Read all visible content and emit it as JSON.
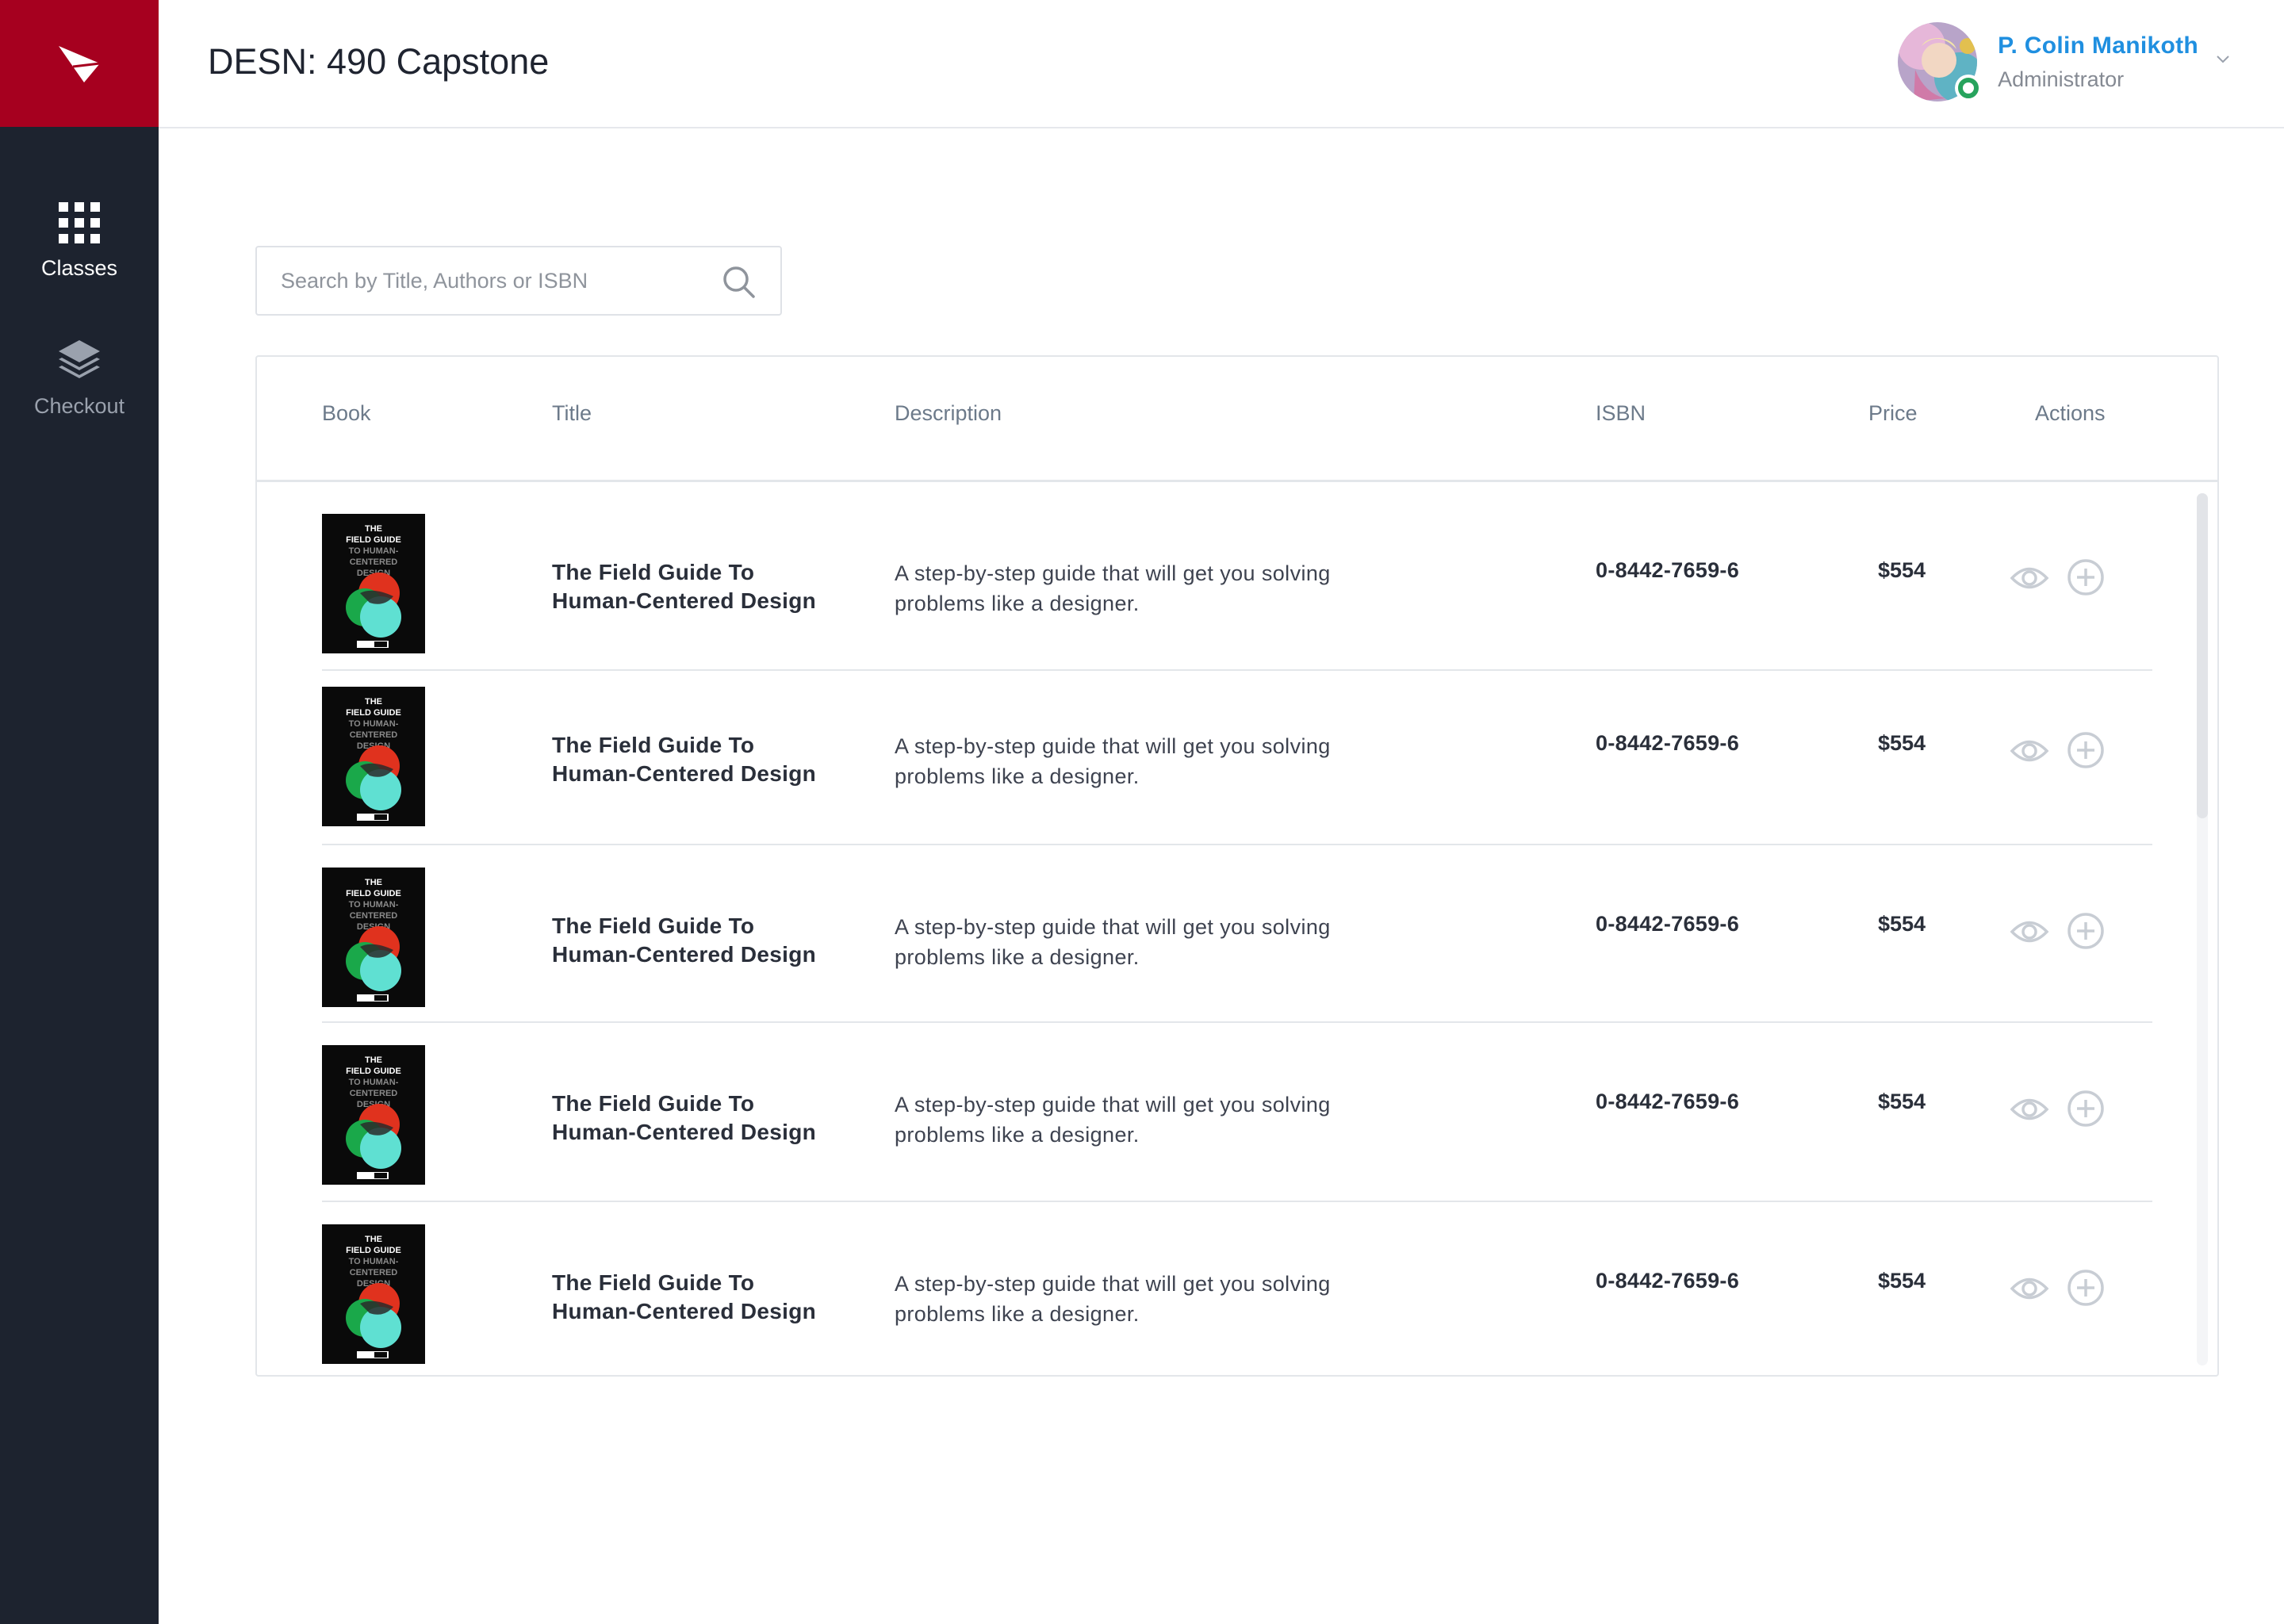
{
  "app": {
    "title": "DESN: 490 Capstone"
  },
  "sidebar": {
    "items": [
      {
        "label": "Classes",
        "icon": "grid-icon",
        "active": true
      },
      {
        "label": "Checkout",
        "icon": "layers-icon",
        "active": false
      }
    ]
  },
  "user": {
    "name": "P. Colin Manikoth",
    "role": "Administrator",
    "status": "online",
    "status_color": "#27a35d"
  },
  "search": {
    "placeholder": "Search by Title, Authors or ISBN",
    "value": ""
  },
  "table": {
    "columns": [
      "Book",
      "Title",
      "Description",
      "ISBN",
      "Price",
      "Actions"
    ],
    "rows": [
      {
        "cover_text": "THE FIELD GUIDE TO HUMAN-CENTERED DESIGN",
        "title_line1": "The Field Guide To",
        "title_line2": "Human-Centered Design",
        "desc_line1": "A step-by-step guide that will get you solving",
        "desc_line2": "problems like a designer.",
        "isbn": "0-8442-7659-6",
        "price": "$554"
      },
      {
        "cover_text": "THE FIELD GUIDE TO HUMAN-CENTERED DESIGN",
        "title_line1": "The Field Guide To",
        "title_line2": "Human-Centered Design",
        "desc_line1": "A step-by-step guide that will get you solving",
        "desc_line2": "problems like a designer.",
        "isbn": "0-8442-7659-6",
        "price": "$554"
      },
      {
        "cover_text": "THE FIELD GUIDE TO HUMAN-CENTERED DESIGN",
        "title_line1": "The Field Guide To",
        "title_line2": "Human-Centered Design",
        "desc_line1": "A step-by-step guide that will get you solving",
        "desc_line2": "problems like a designer.",
        "isbn": "0-8442-7659-6",
        "price": "$554"
      },
      {
        "cover_text": "THE FIELD GUIDE TO HUMAN-CENTERED DESIGN",
        "title_line1": "The Field Guide To",
        "title_line2": "Human-Centered Design",
        "desc_line1": "A step-by-step guide that will get you solving",
        "desc_line2": "problems like a designer.",
        "isbn": "0-8442-7659-6",
        "price": "$554"
      },
      {
        "cover_text": "THE FIELD GUIDE TO HUMAN-CENTERED DESIGN",
        "title_line1": "The Field Guide To",
        "title_line2": "Human-Centered Design",
        "desc_line1": "A step-by-step guide that will get you solving",
        "desc_line2": "problems like a designer.",
        "isbn": "0-8442-7659-6",
        "price": "$554"
      }
    ],
    "row_actions": [
      "eye-icon",
      "plus-circle-icon"
    ]
  },
  "colors": {
    "brand": "#a6001f",
    "sidebar_bg": "#1d232f",
    "link": "#1f8fe0"
  }
}
